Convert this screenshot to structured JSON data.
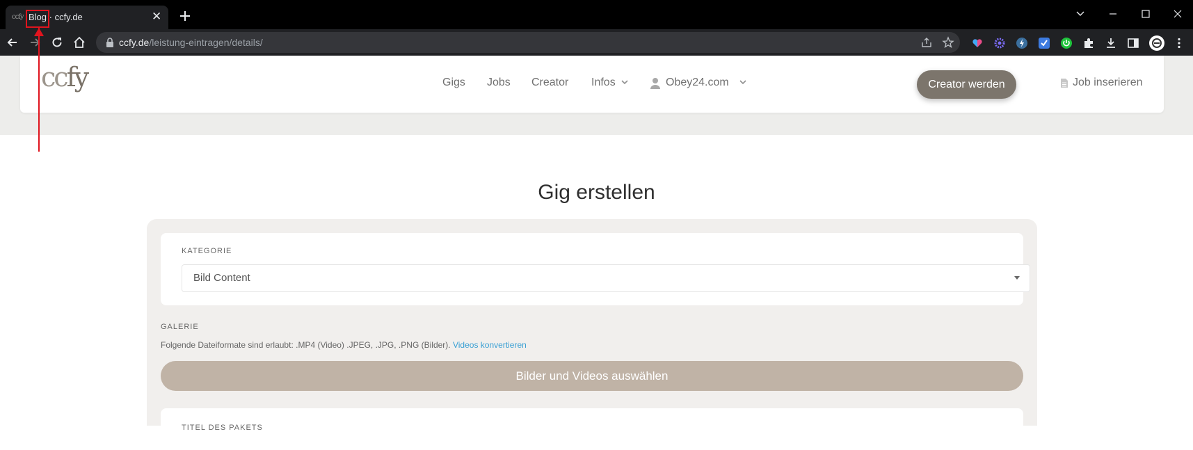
{
  "browser": {
    "tab": {
      "favicon_text": "ccfy",
      "title": "Blog · ccfy.de",
      "close_glyph": "✕"
    },
    "url_host": "ccfy.de",
    "url_path": "/leistung-eintragen/details/"
  },
  "site": {
    "logo_part1": "cc",
    "logo_part2": "fy",
    "nav": {
      "gigs": "Gigs",
      "jobs": "Jobs",
      "creator": "Creator",
      "infos": "Infos",
      "account": "Obey24.com"
    },
    "cta_label": "Creator werden",
    "job_link": "Job inserieren"
  },
  "page": {
    "title": "Gig erstellen",
    "kategorie_label": "KATEGORIE",
    "kategorie_value": "Bild Content",
    "galerie_label": "GALERIE",
    "galerie_info": "Folgende Dateiformate sind erlaubt: .MP4 (Video) .JPEG, .JPG, .PNG (Bilder).",
    "galerie_link": "Videos konvertieren",
    "upload_button": "Bilder und Videos auswählen",
    "paket_label": "TITEL DES PAKETS"
  },
  "colors": {
    "annotation": "#e0141e",
    "cta": "#7c756c",
    "upload": "#c0b3a6",
    "link": "#3aa0d4"
  }
}
